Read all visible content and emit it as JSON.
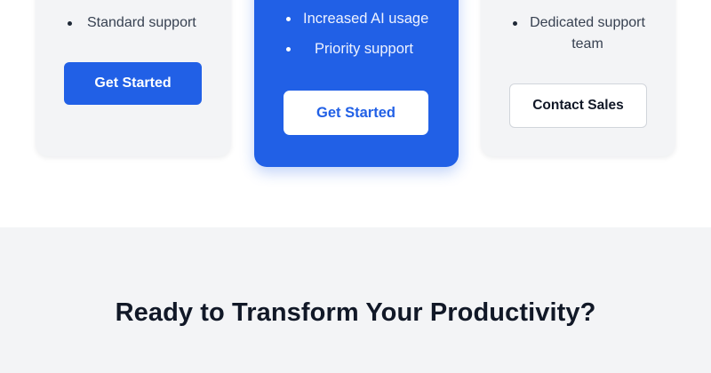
{
  "pricing": {
    "plans": [
      {
        "features": [
          "Standard support"
        ],
        "cta_label": "Get Started"
      },
      {
        "features": [
          "Increased AI usage",
          "Priority support"
        ],
        "cta_label": "Get Started"
      },
      {
        "features": [
          "Dedicated support team"
        ],
        "cta_label": "Contact Sales"
      }
    ]
  },
  "cta": {
    "title": "Ready to Transform Your Productivity?"
  },
  "colors": {
    "accent": "#2160e6",
    "card_bg": "#f3f4f6",
    "section_bg": "#f3f4f6",
    "heading": "#111827"
  }
}
